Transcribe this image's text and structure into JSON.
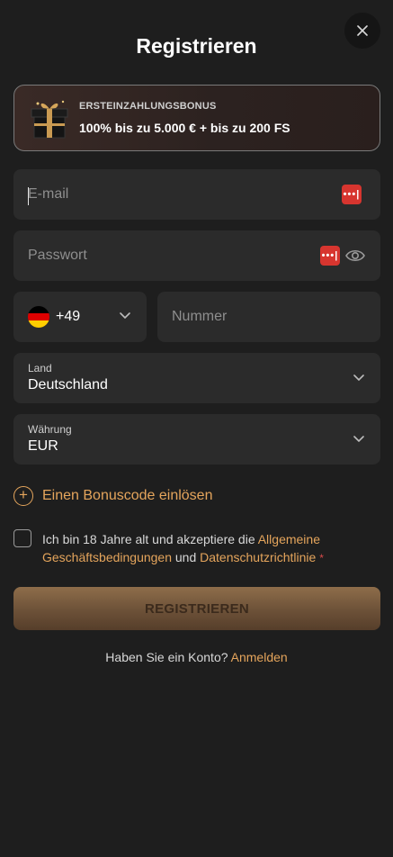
{
  "header": {
    "title": "Registrieren",
    "close_icon": "close-icon"
  },
  "bonus": {
    "label": "ERSTEINZAHLUNGSBONUS",
    "text": "100% bis zu 5.000 € + bis zu 200 FS",
    "icon": "gift-box-icon"
  },
  "form": {
    "email_placeholder": "E-mail",
    "password_placeholder": "Passwort",
    "phone": {
      "dial_code": "+49",
      "number_placeholder": "Nummer",
      "flag": "germany-flag-icon"
    },
    "country": {
      "label": "Land",
      "value": "Deutschland"
    },
    "currency": {
      "label": "Währung",
      "value": "EUR"
    },
    "bonuscode_label": "Einen Bonuscode einlösen",
    "terms": {
      "prefix": "Ich bin 18 Jahre alt und akzeptiere die ",
      "link1": "Allgemeine Geschäftsbedingungen",
      "middle": " und ",
      "link2": "Datenschutzrichtlinie",
      "required_mark": "*"
    },
    "submit_label": "REGISTRIEREN"
  },
  "footer": {
    "prompt": "Haben Sie ein Konto? ",
    "login_link": "Anmelden"
  },
  "colors": {
    "accent": "#e5a55c",
    "background": "#1e1e1e",
    "field": "#2b2b2b",
    "password_manager": "#d7352f"
  }
}
